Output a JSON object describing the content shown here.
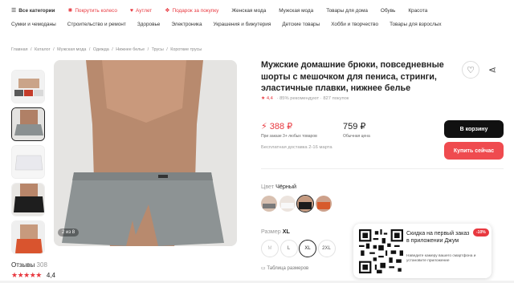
{
  "nav": {
    "row1": [
      {
        "label": "Все категории",
        "icon": "menu-icon",
        "bold": true
      },
      {
        "label": "Покрутить колесо",
        "icon": "wheel-icon",
        "red": true
      },
      {
        "label": "Аутлет",
        "icon": "heart-icon",
        "red": true
      },
      {
        "label": "Подарок за покупку",
        "icon": "gift-icon",
        "red": true
      },
      {
        "label": "Женская мода"
      },
      {
        "label": "Мужская мода"
      },
      {
        "label": "Товары для дома"
      },
      {
        "label": "Обувь"
      },
      {
        "label": "Красота"
      }
    ],
    "row2": [
      {
        "label": "Сумки и чемоданы"
      },
      {
        "label": "Строительство и ремонт"
      },
      {
        "label": "Здоровье"
      },
      {
        "label": "Электроника"
      },
      {
        "label": "Украшения и бижутерия"
      },
      {
        "label": "Детские товары"
      },
      {
        "label": "Хобби и творчество"
      },
      {
        "label": "Товары для взрослых"
      }
    ]
  },
  "breadcrumb": [
    "Главная",
    "Каталог",
    "Мужская мода",
    "Одежда",
    "Нижнее белье",
    "Трусы",
    "Короткие трусы"
  ],
  "gallery": {
    "counter": "2 из 8"
  },
  "reviews": {
    "title": "Отзывы",
    "count": "308",
    "stars": "★★★★★",
    "rating": "4,4"
  },
  "product": {
    "title": "Мужские домашние брюки, повседневные шорты с мешочком для пениса, стринги, эластичные плавки, нижнее белье",
    "rating": "4,4",
    "recommend": "85% рекомендуют",
    "purchases": "827 покупок"
  },
  "price": {
    "new": "388 ₽",
    "new_note": "При заказе 3+ любых товаров",
    "old": "759 ₽",
    "old_note": "Обычная цена"
  },
  "delivery": "Бесплатная доставка 2-16 марта",
  "buttons": {
    "cart": "В корзину",
    "buy": "Купить сейчас"
  },
  "color": {
    "label": "Цвет",
    "value": "Чёрный"
  },
  "size": {
    "label": "Размер",
    "value": "XL",
    "options": [
      "M",
      "L",
      "XL",
      "2XL"
    ]
  },
  "size_table": "Таблица размеров",
  "promo": {
    "title": "Скидка на первый заказ в приложении Джум",
    "subtitle": "Наведите камеру вашего смартфона и установите приложение",
    "badge": "-10%"
  },
  "colors": {
    "accent": "#e8383f",
    "dark": "#111111",
    "buy": "#ef4b4f"
  }
}
